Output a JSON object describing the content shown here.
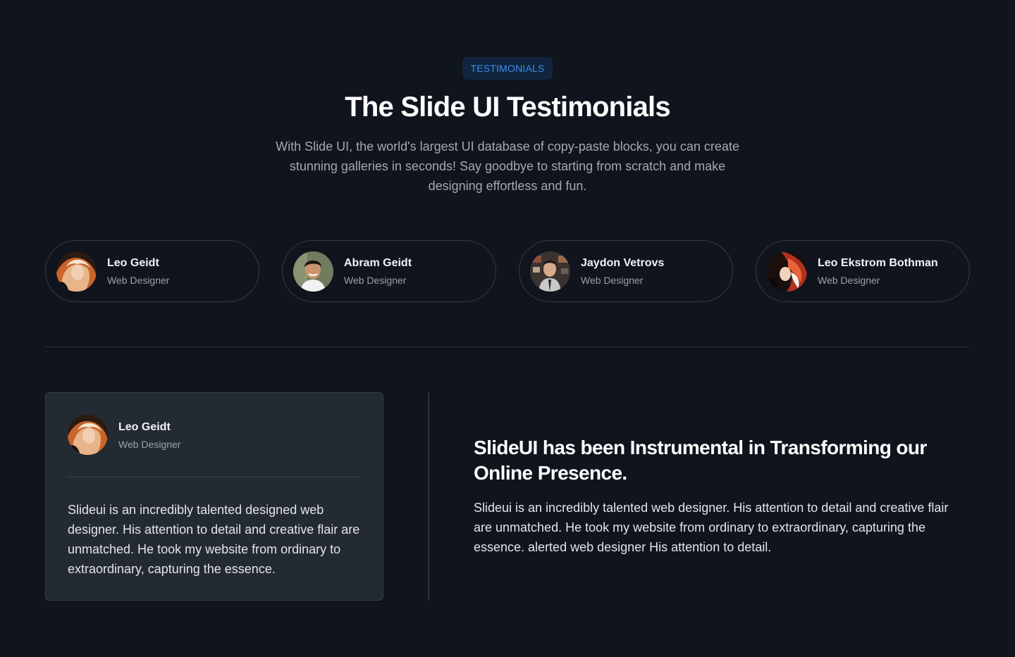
{
  "header": {
    "badge": "TESTIMONIALS",
    "title": "The Slide UI Testimonials",
    "subtitle": "With Slide UI, the world's largest UI database of copy-paste blocks, you can create stunning galleries in seconds! Say goodbye to starting from scratch and make designing effortless and fun."
  },
  "people": [
    {
      "name": "Leo Geidt",
      "role": "Web Designer",
      "avatar_icon": "avatar-photo"
    },
    {
      "name": "Abram Geidt",
      "role": "Web Designer",
      "avatar_icon": "avatar-photo"
    },
    {
      "name": "Jaydon Vetrovs",
      "role": "Web Designer",
      "avatar_icon": "avatar-photo"
    },
    {
      "name": "Leo Ekstrom Bothman",
      "role": "Web Designer",
      "avatar_icon": "avatar-photo"
    }
  ],
  "selected": {
    "name": "Leo Geidt",
    "role": "Web Designer",
    "quote": "Slideui is an incredibly talented designed web designer. His attention to detail and creative flair are unmatched. He took my website from ordinary to extraordinary, capturing the essence."
  },
  "feature": {
    "headline": "SlideUI has been Instrumental in Transforming our Online Presence.",
    "body": "Slideui is an incredibly talented web designer. His attention to detail and creative flair are unmatched. He took my website from ordinary to extraordinary, capturing the essence. alerted web designer His attention to detail."
  },
  "colors": {
    "background": "#0f141d",
    "accent": "#3b8df0",
    "card": "#232a32"
  }
}
